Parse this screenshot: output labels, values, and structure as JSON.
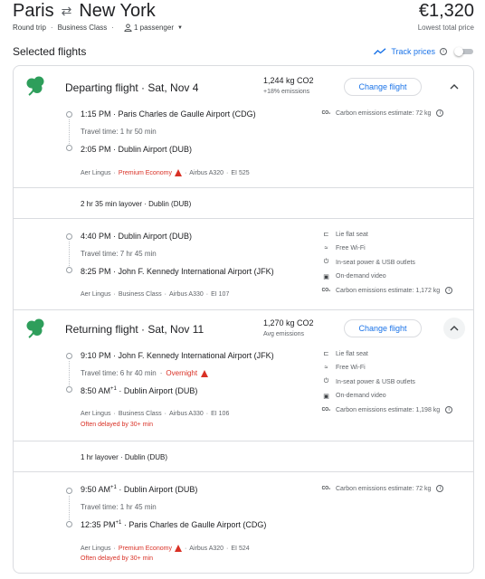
{
  "header": {
    "origin": "Paris",
    "destination": "New York",
    "price": "€1,320",
    "price_note": "Lowest total price",
    "trip_type": "Round trip",
    "cabin": "Business Class",
    "passengers": "1 passenger"
  },
  "section_title": "Selected flights",
  "track_prices_label": "Track prices",
  "change_flight_label": "Change flight",
  "departing": {
    "title": "Departing flight · Sat, Nov 4",
    "co2": "1,244 kg CO2",
    "co2_note": "+18% emissions",
    "leg1": {
      "dep_time": "1:15 PM",
      "dep_airport": "Paris Charles de Gaulle Airport (CDG)",
      "travel_time": "Travel time: 1 hr 50 min",
      "arr_time": "2:05 PM",
      "arr_airport": "Dublin Airport (DUB)",
      "airline": "Aer Lingus",
      "cabin": "Premium Economy",
      "aircraft": "Airbus A320",
      "flight_no": "EI 525",
      "emissions": "Carbon emissions estimate: 72 kg"
    },
    "layover": "2 hr 35 min layover · Dublin (DUB)",
    "leg2": {
      "dep_time": "4:40 PM",
      "dep_airport": "Dublin Airport (DUB)",
      "travel_time": "Travel time: 7 hr 45 min",
      "arr_time": "8:25 PM",
      "arr_airport": "John F. Kennedy International Airport (JFK)",
      "airline": "Aer Lingus",
      "cabin": "Business Class",
      "aircraft": "Airbus A330",
      "flight_no": "EI 107",
      "amenities": [
        "Lie flat seat",
        "Free Wi-Fi",
        "In-seat power & USB outlets",
        "On-demand video"
      ],
      "emissions": "Carbon emissions estimate: 1,172 kg"
    }
  },
  "returning": {
    "title": "Returning flight · Sat, Nov 11",
    "co2": "1,270 kg CO2",
    "co2_note": "Avg emissions",
    "leg1": {
      "dep_time": "9:10 PM",
      "dep_airport": "John F. Kennedy International Airport (JFK)",
      "travel_time": "Travel time: 6 hr 40 min",
      "overnight": "Overnight",
      "arr_time": "8:50 AM",
      "arr_plus": "+1",
      "arr_airport": "Dublin Airport (DUB)",
      "airline": "Aer Lingus",
      "cabin": "Business Class",
      "aircraft": "Airbus A330",
      "flight_no": "EI 106",
      "delay": "Often delayed by 30+ min",
      "amenities": [
        "Lie flat seat",
        "Free Wi-Fi",
        "In-seat power & USB outlets",
        "On-demand video"
      ],
      "emissions": "Carbon emissions estimate: 1,198 kg"
    },
    "layover": "1 hr layover · Dublin (DUB)",
    "leg2": {
      "dep_time": "9:50 AM",
      "dep_plus": "+1",
      "dep_airport": "Dublin Airport (DUB)",
      "travel_time": "Travel time: 1 hr 45 min",
      "arr_time": "12:35 PM",
      "arr_plus": "+1",
      "arr_airport": "Paris Charles de Gaulle Airport (CDG)",
      "airline": "Aer Lingus",
      "cabin": "Premium Economy",
      "aircraft": "Airbus A320",
      "flight_no": "EI 524",
      "delay": "Often delayed by 30+ min",
      "emissions": "Carbon emissions estimate: 72 kg"
    }
  },
  "colors": {
    "accent": "#1a73e8",
    "warning": "#d93025",
    "airline_green": "#2e9e5b",
    "border": "#dadce0"
  }
}
